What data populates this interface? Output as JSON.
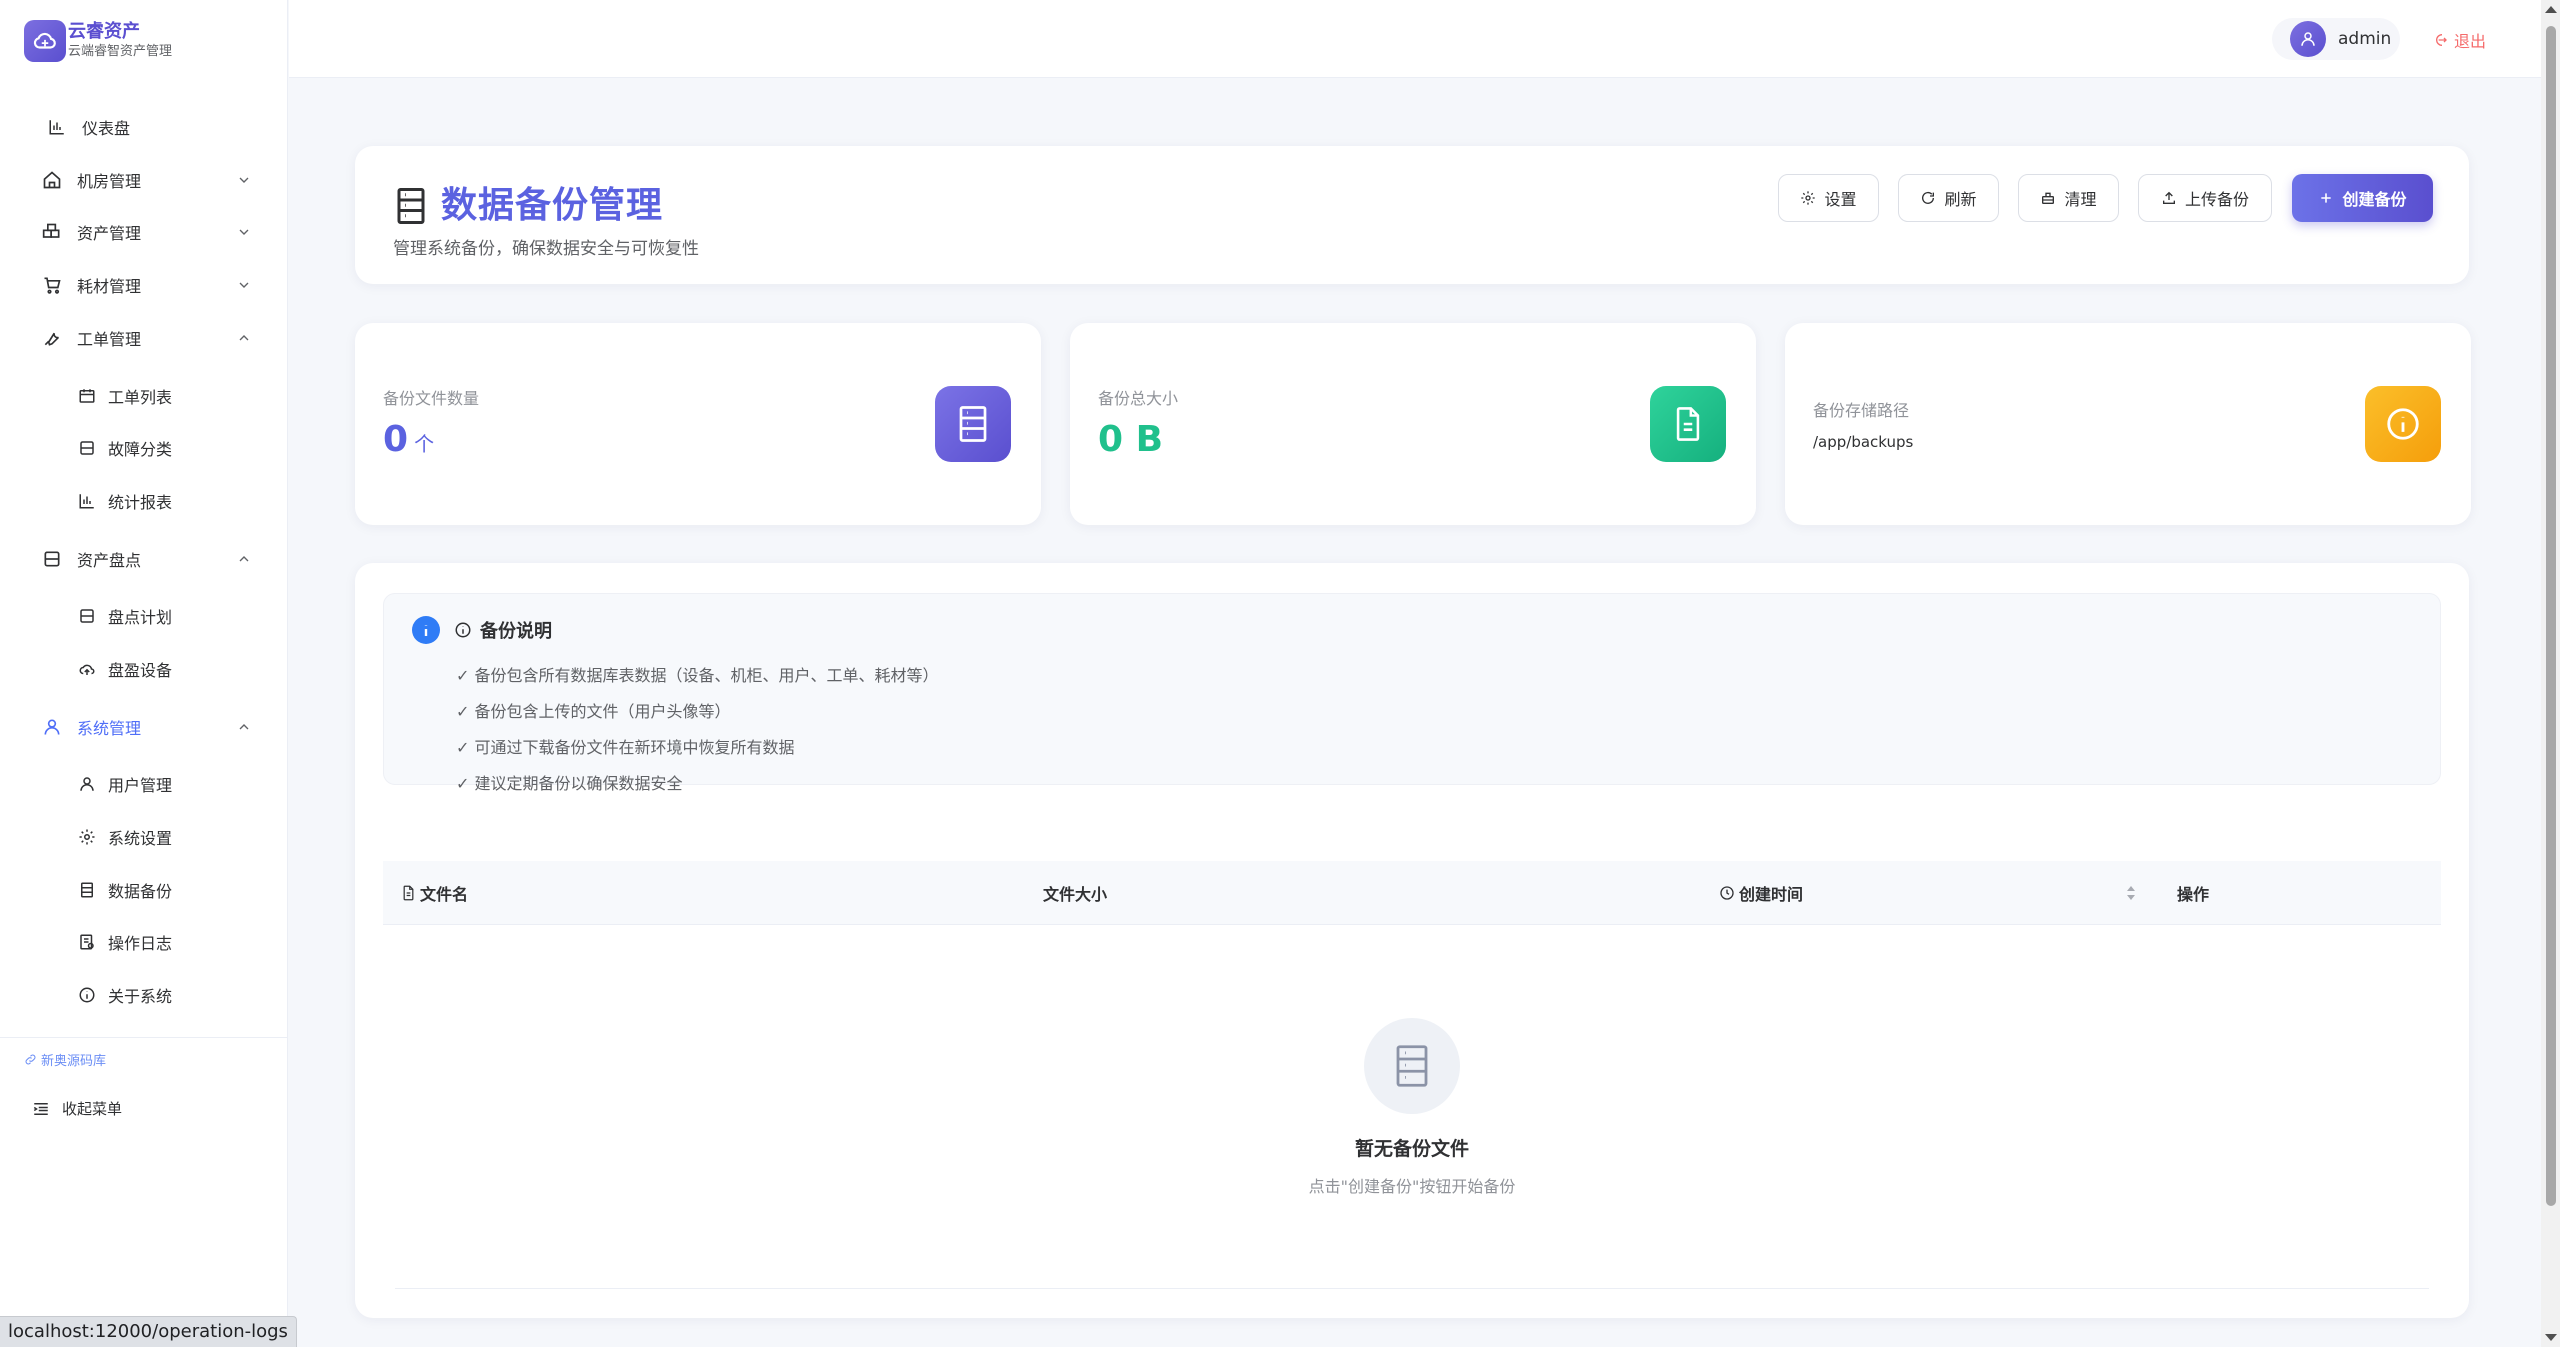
{
  "brand": {
    "title": "云睿资产",
    "subtitle": "云端睿智资产管理"
  },
  "sidebar": {
    "dashboard": "仪表盘",
    "room": "机房管理",
    "asset": "资产管理",
    "consumable": "耗材管理",
    "workorder": "工单管理",
    "workorder_list": "工单列表",
    "fault_category": "故障分类",
    "stat_report": "统计报表",
    "inventory": "资产盘点",
    "inventory_plan": "盘点计划",
    "inventory_surplus": "盘盈设备",
    "system": "系统管理",
    "user_mgmt": "用户管理",
    "sys_settings": "系统设置",
    "data_backup": "数据备份",
    "op_logs": "操作日志",
    "about": "关于系统",
    "source_link": "新奥源码库",
    "collapse": "收起菜单"
  },
  "statusbar": {
    "url": "localhost:12000/operation-logs"
  },
  "header": {
    "user": "admin",
    "logout": "退出"
  },
  "page": {
    "title": "数据备份管理",
    "subtitle": "管理系统备份，确保数据安全与可恢复性",
    "buttons": {
      "settings": "设置",
      "refresh": "刷新",
      "clean": "清理",
      "upload": "上传备份",
      "create": "创建备份"
    }
  },
  "stats": {
    "count_label": "备份文件数量",
    "count_value": "0",
    "count_unit": "个",
    "size_label": "备份总大小",
    "size_value": "0 B",
    "path_label": "备份存储路径",
    "path_value": "/app/backups"
  },
  "notice": {
    "title": "备份说明",
    "lines": [
      "✓ 备份包含所有数据库表数据（设备、机柜、用户、工单、耗材等）",
      "✓ 备份包含上传的文件（用户头像等）",
      "✓ 可通过下载备份文件在新环境中恢复所有数据",
      "✓ 建议定期备份以确保数据安全"
    ]
  },
  "table": {
    "col_filename": "文件名",
    "col_size": "文件大小",
    "col_created": "创建时间",
    "col_actions": "操作"
  },
  "empty": {
    "title": "暂无备份文件",
    "hint": "点击\"创建备份\"按钮开始备份"
  },
  "colors": {
    "primary": "#5b62e0",
    "accent_blue": "#4f6ef7",
    "green": "#20c08c",
    "orange": "#f7a51e",
    "danger": "#f56c6c"
  }
}
